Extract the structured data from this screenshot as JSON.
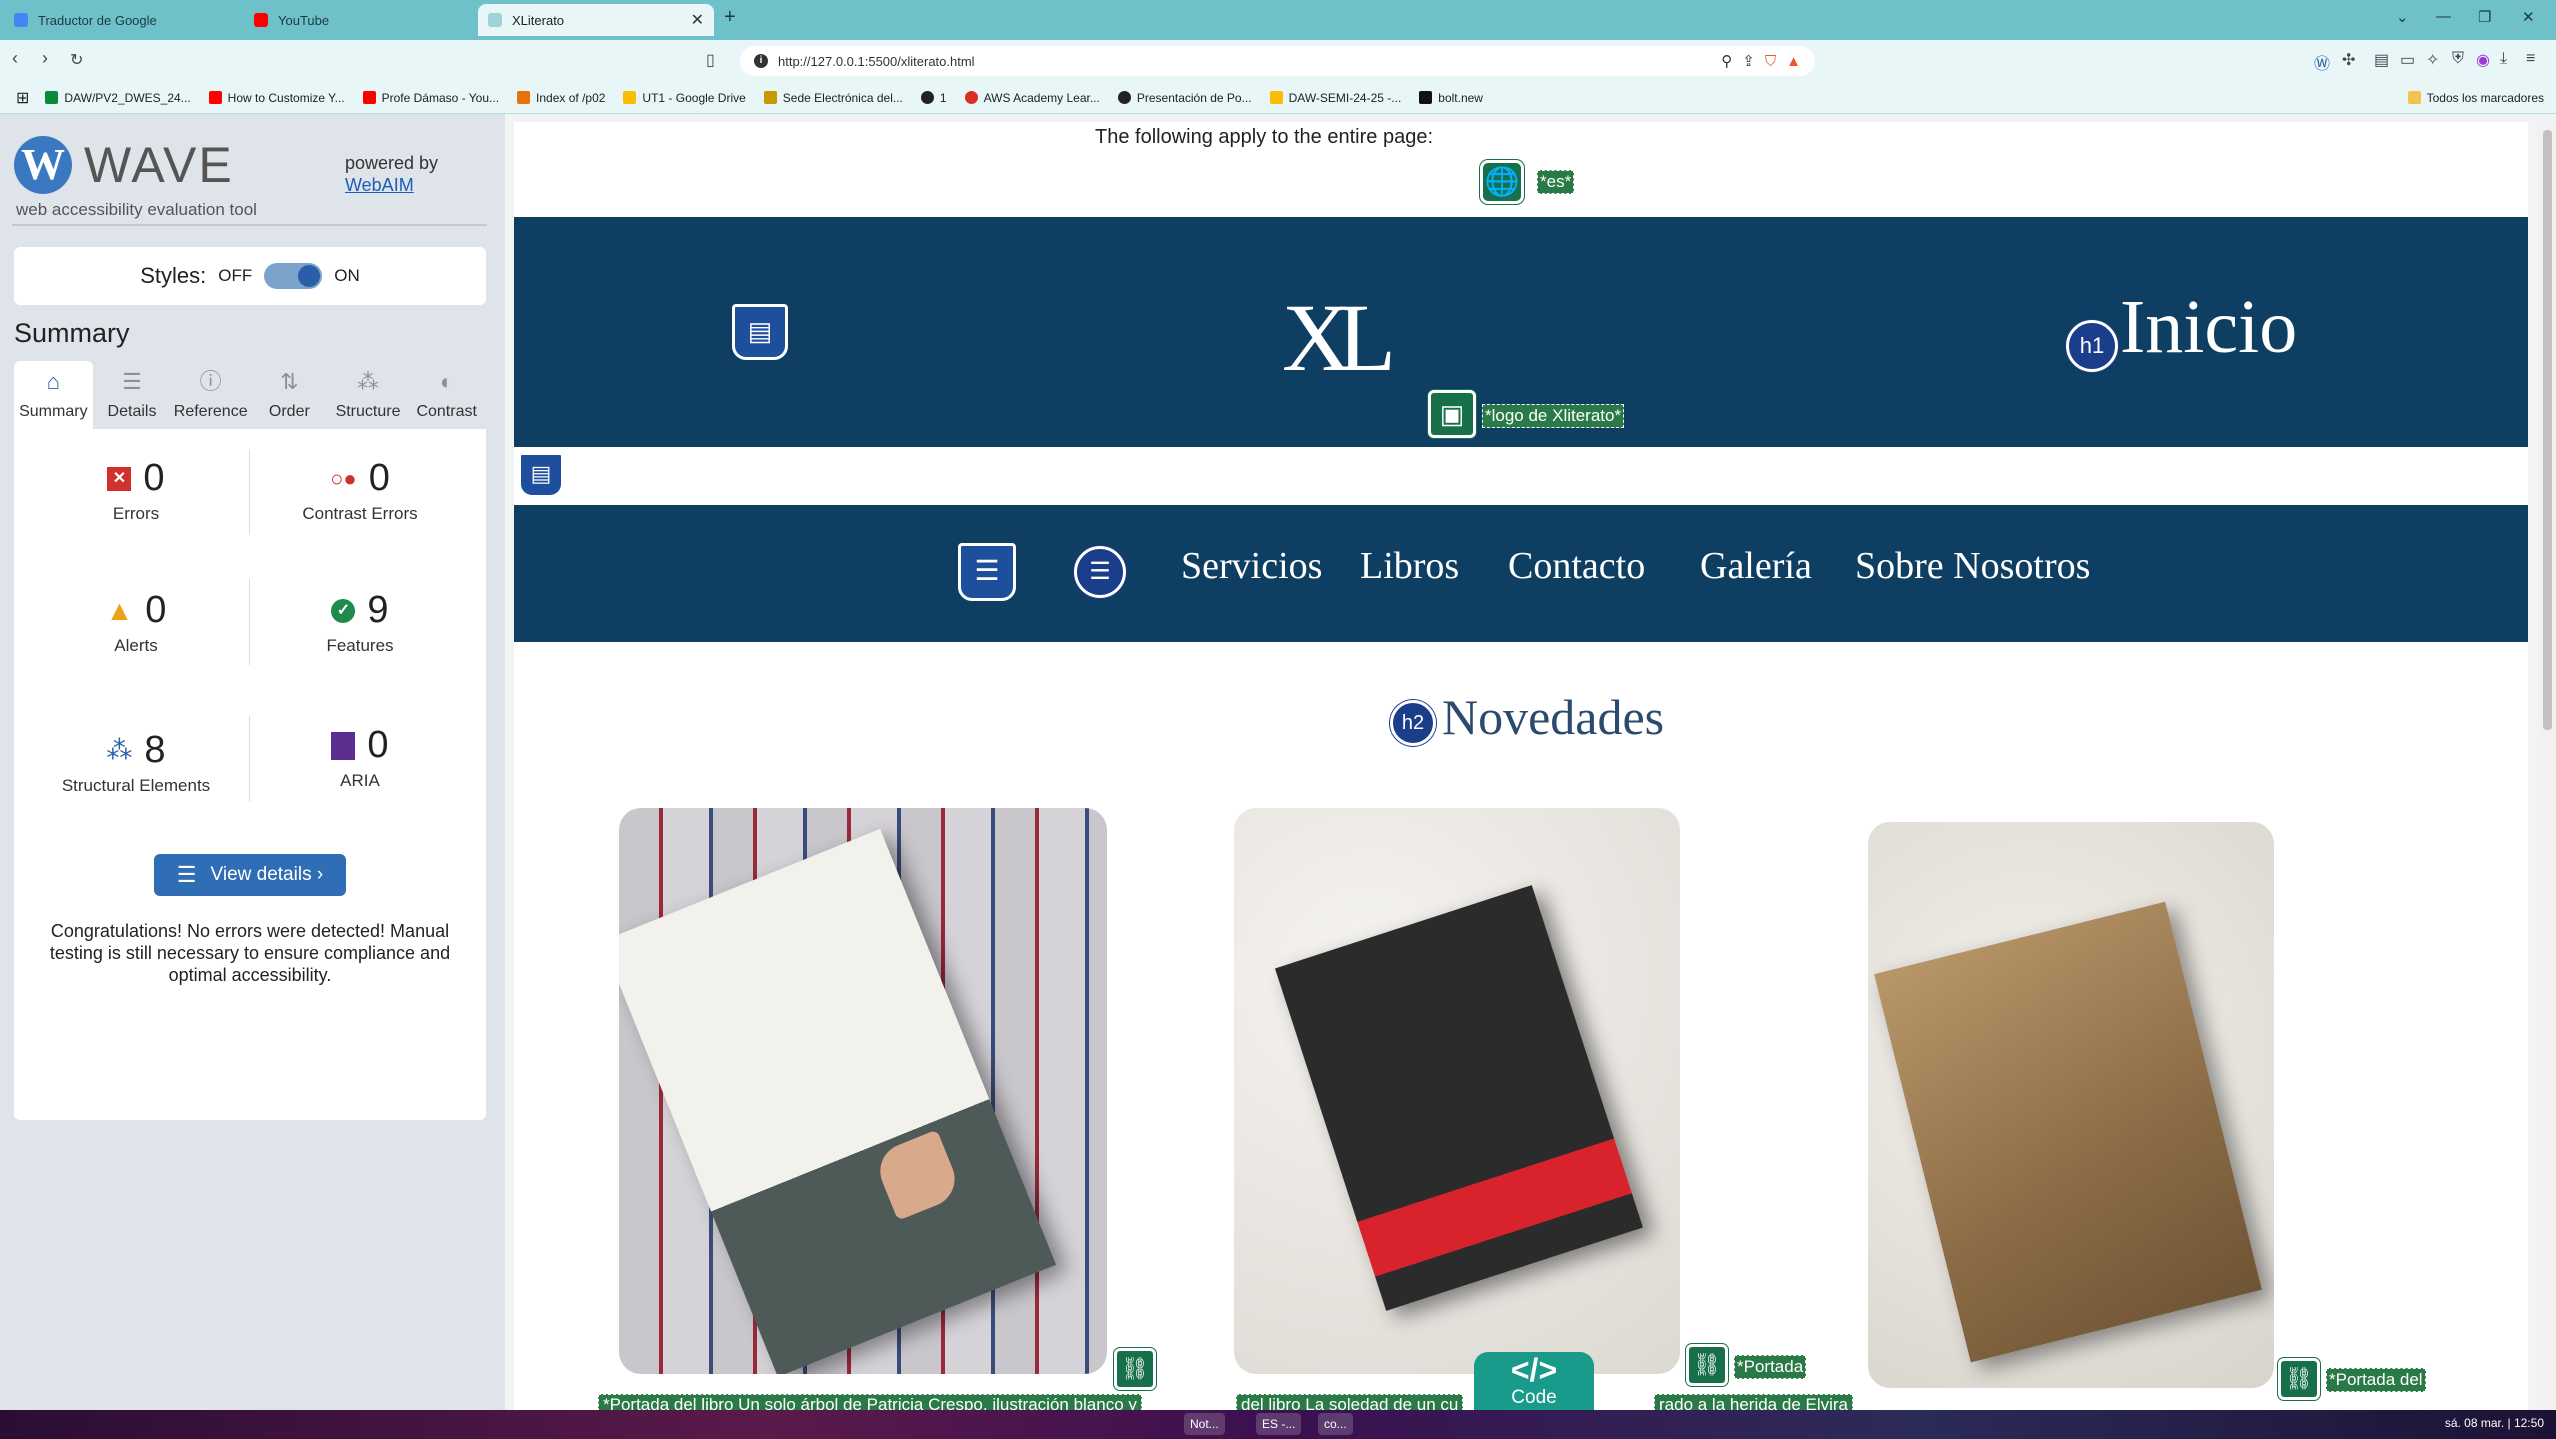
{
  "browser": {
    "tabs": [
      {
        "title": "Traductor de Google",
        "favicon_color": "#4285f4"
      },
      {
        "title": "YouTube",
        "favicon_color": "#ff0000"
      },
      {
        "title": "XLiterato",
        "favicon_color": "#9fd3d8",
        "active": true
      }
    ],
    "new_tab": "+",
    "url": "http://127.0.0.1:5500/xliterato.html",
    "bookmarks": [
      {
        "label": "DAW/PV2_DWES_24...",
        "color": "#0a8a3a"
      },
      {
        "label": "How to Customize Y...",
        "color": "#ff0000"
      },
      {
        "label": "Profe Dámaso - You...",
        "color": "#ff0000"
      },
      {
        "label": "Index of /p02",
        "color": "#e8710a"
      },
      {
        "label": "UT1 - Google Drive",
        "color": "#fbbc04"
      },
      {
        "label": "Sede Electrónica del...",
        "color": "#c59a00"
      },
      {
        "label": "1",
        "color": "#222222"
      },
      {
        "label": "AWS Academy Lear...",
        "color": "#d93025"
      },
      {
        "label": "Presentación de Po...",
        "color": "#222222"
      },
      {
        "label": "DAW-SEMI-24-25 -...",
        "color": "#fbbc04"
      },
      {
        "label": "bolt.new",
        "color": "#111111"
      }
    ],
    "all_bookmarks": "Todos los marcadores"
  },
  "wave": {
    "logo_letter": "W",
    "name": "WAVE",
    "subtitle": "web accessibility evaluation tool",
    "powered_by": "powered by",
    "powered_link": "WebAIM",
    "styles_label": "Styles:",
    "styles_off": "OFF",
    "styles_on": "ON",
    "summary_heading": "Summary",
    "tabs": [
      {
        "label": "Summary",
        "icon": "⌂"
      },
      {
        "label": "Details",
        "icon": "☰"
      },
      {
        "label": "Reference",
        "icon": "ⓘ"
      },
      {
        "label": "Order",
        "icon": "⇅"
      },
      {
        "label": "Structure",
        "icon": "⁂"
      },
      {
        "label": "Contrast",
        "icon": "◐"
      }
    ],
    "stats": {
      "errors": {
        "value": "0",
        "label": "Errors",
        "color": "#d0312d"
      },
      "contrast": {
        "value": "0",
        "label": "Contrast Errors",
        "color": "#d0312d"
      },
      "alerts": {
        "value": "0",
        "label": "Alerts",
        "color": "#e8a317"
      },
      "features": {
        "value": "9",
        "label": "Features",
        "color": "#1e8a4c"
      },
      "structural": {
        "value": "8",
        "label": "Structural Elements",
        "color": "#2b5ea8"
      },
      "aria": {
        "value": "0",
        "label": "ARIA",
        "color": "#5b2d8e"
      }
    },
    "view_details": "View details ›",
    "congrats": "Congratulations! No errors were detected! Manual testing is still necessary to ensure compliance and optimal accessibility."
  },
  "page": {
    "applies_text": "The following apply to the entire page:",
    "lang_label": "*es*",
    "logo_text": "XL",
    "logo_alt_label": "*logo de Xliterato*",
    "h1_badge": "h1",
    "h1_text": "Inicio",
    "nav_links": [
      "Servicios",
      "Libros",
      "Contacto",
      "Galería",
      "Sobre Nosotros"
    ],
    "h2_badge": "h2",
    "h2_text": "Novedades",
    "captions": {
      "book1": "*Portada del libro Un solo árbol de Patricia Crespo, ilustración blanco y",
      "book2": "del libro La soledad de un cu",
      "book2b": "rado a la herida de Elvira",
      "book2_label": "*Portada",
      "book3_label": "*Portada del"
    },
    "code_symbol": "</>",
    "code_label": "Code"
  },
  "taskbar": {
    "items": [
      "Not...",
      "ES -...",
      "co..."
    ],
    "clock": "sá. 08 mar. | 12:50"
  },
  "colors": {
    "tabbar": "#6ec1c9",
    "banner": "#0e3f63",
    "wave_feature": "#2a7a47",
    "heading_badge": "#1b3e8a"
  }
}
